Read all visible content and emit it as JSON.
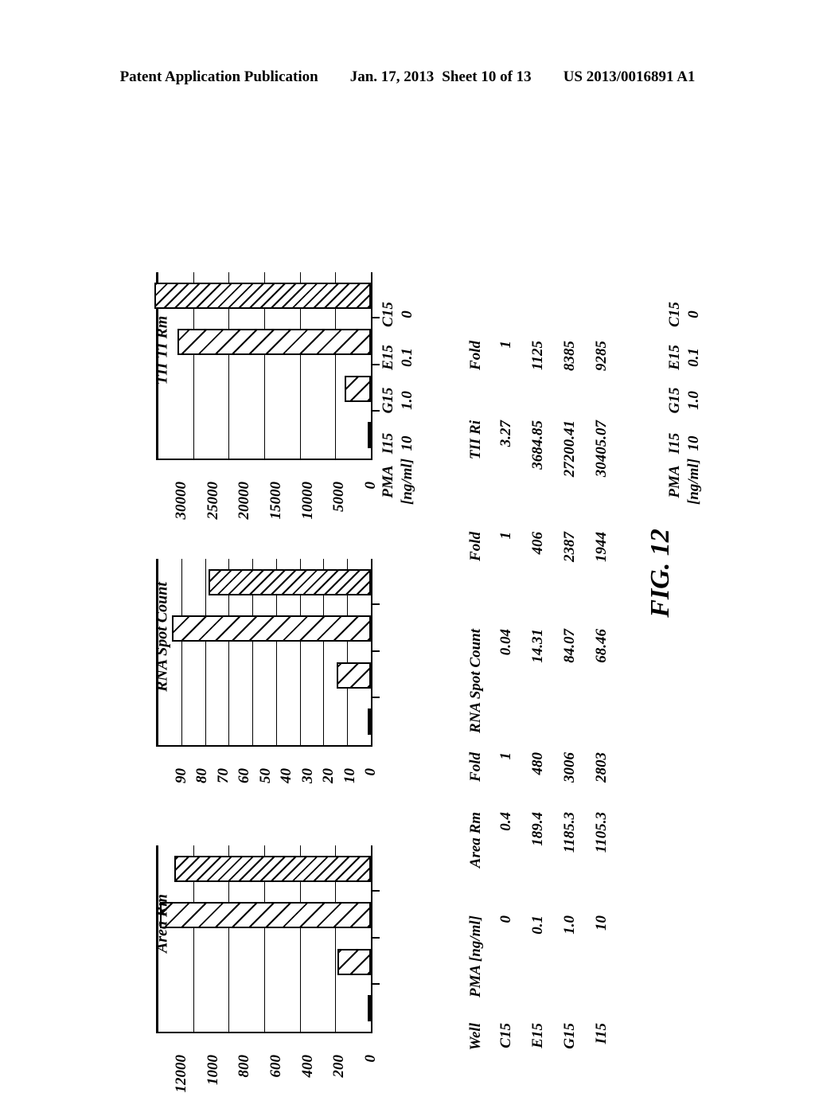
{
  "header": {
    "publication": "Patent Application Publication",
    "date": "Jan. 17, 2013",
    "sheet": "Sheet 10 of 13",
    "patent_number": "US 2013/0016891 A1"
  },
  "figure": {
    "caption": "FIG. 12"
  },
  "axis_caption": {
    "line1": "PMA",
    "line2": "[ng/ml]"
  },
  "table": {
    "headers": [
      "Well",
      "PMA [ng/ml]",
      "Area Rm",
      "Fold",
      "RNA Spot Count",
      "Fold",
      "TII Ri",
      "Fold"
    ],
    "rows": [
      {
        "well": "C15",
        "pma": "0",
        "area_rm": "0.4",
        "area_fold": "1",
        "rna_spot_count": "0.04",
        "rna_fold": "1",
        "tii_ri": "3.27",
        "tii_fold": "1"
      },
      {
        "well": "E15",
        "pma": "0.1",
        "area_rm": "189.4",
        "area_fold": "480",
        "rna_spot_count": "14.31",
        "rna_fold": "406",
        "tii_ri": "3684.85",
        "tii_fold": "1125"
      },
      {
        "well": "G15",
        "pma": "1.0",
        "area_rm": "1185.3",
        "area_fold": "3006",
        "rna_spot_count": "84.07",
        "rna_fold": "2387",
        "tii_ri": "27200.41",
        "tii_fold": "8385"
      },
      {
        "well": "I15",
        "pma": "10",
        "area_rm": "1105.3",
        "area_fold": "2803",
        "rna_spot_count": "68.46",
        "rna_fold": "1944",
        "tii_ri": "30405.07",
        "tii_fold": "9285"
      }
    ]
  },
  "chart_data": [
    {
      "type": "bar",
      "title": "TII TI Rm",
      "orientation": "horizontal",
      "categories": [
        "C15",
        "E15",
        "G15",
        "I15"
      ],
      "category_sublabels": [
        "0",
        "0.1",
        "1.0",
        "10"
      ],
      "xlabel": "PMA [ng/ml]",
      "ylabel": "",
      "values": [
        3.27,
        3684.85,
        27200.41,
        30405.07
      ],
      "ylim": [
        0,
        30000
      ],
      "yticks": [
        0,
        5000,
        10000,
        15000,
        20000,
        25000,
        30000
      ],
      "ytick_labels": [
        "0",
        "5000",
        "10000",
        "15000",
        "20000",
        "25000",
        "30000"
      ],
      "grid": true,
      "legend": "none"
    },
    {
      "type": "bar",
      "title": "RNA Spot Count",
      "orientation": "horizontal",
      "categories": [
        "C15",
        "E15",
        "G15",
        "I15"
      ],
      "category_sublabels": [
        "0",
        "0.1",
        "1.0",
        "10"
      ],
      "xlabel": "PMA [ng/ml]",
      "ylabel": "",
      "values": [
        0.04,
        14.31,
        84.07,
        68.46
      ],
      "ylim": [
        0,
        90
      ],
      "yticks": [
        0,
        10,
        20,
        30,
        40,
        50,
        60,
        70,
        80,
        90
      ],
      "ytick_labels": [
        "0",
        "10",
        "20",
        "30",
        "40",
        "50",
        "60",
        "70",
        "80",
        "90"
      ],
      "grid": true,
      "legend": "none"
    },
    {
      "type": "bar",
      "title": "Area Rm",
      "orientation": "horizontal",
      "categories": [
        "C15",
        "E15",
        "G15",
        "I15"
      ],
      "category_sublabels": [
        "0",
        "0.1",
        "1.0",
        "10"
      ],
      "xlabel": "PMA [ng/ml]",
      "ylabel": "",
      "values": [
        0.4,
        189.4,
        1185.3,
        1105.3
      ],
      "ylim": [
        0,
        1200
      ],
      "yticks": [
        0,
        200,
        400,
        600,
        800,
        1000,
        1200
      ],
      "ytick_labels": [
        "0",
        "200",
        "400",
        "600",
        "800",
        "1000",
        "12000"
      ],
      "grid": true,
      "legend": "none"
    }
  ]
}
